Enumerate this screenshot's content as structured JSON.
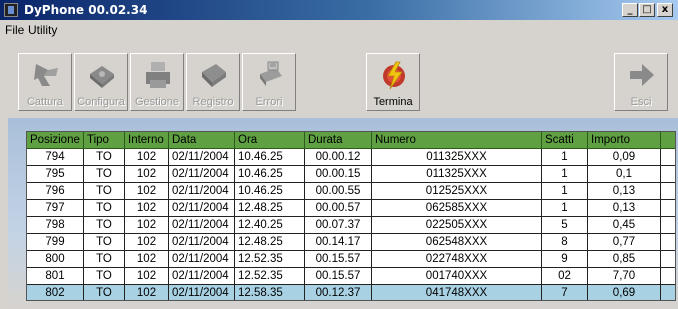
{
  "window": {
    "title": "DyPhone 00.02.34",
    "controls": [
      "_",
      "□",
      "x"
    ]
  },
  "menu": [
    "File",
    "Utility"
  ],
  "toolbar": [
    {
      "label": "Cattura",
      "icon": "capture-icon",
      "enabled": false
    },
    {
      "label": "Configura",
      "icon": "configure-icon",
      "enabled": false
    },
    {
      "label": "Gestione",
      "icon": "manage-icon",
      "enabled": false
    },
    {
      "label": "Registro",
      "icon": "register-icon",
      "enabled": false
    },
    {
      "label": "Errori",
      "icon": "errors-icon",
      "enabled": false
    },
    {
      "label": "Termina",
      "icon": "terminate-icon",
      "enabled": true
    },
    {
      "label": "Esci",
      "icon": "exit-arrow-icon",
      "enabled": false
    }
  ],
  "table": {
    "columns": [
      "Posizione",
      "Tipo",
      "Interno",
      "Data",
      "Ora",
      "Durata",
      "Numero",
      "Scatti",
      "Importo"
    ],
    "rows": [
      [
        "794",
        "TO",
        "102",
        "02/11/2004",
        "10.46.25",
        "00.00.12",
        "011325XXX",
        "1",
        "0,09"
      ],
      [
        "795",
        "TO",
        "102",
        "02/11/2004",
        "10.46.25",
        "00.00.15",
        "011325XXX",
        "1",
        "0,1"
      ],
      [
        "796",
        "TO",
        "102",
        "02/11/2004",
        "10.46.25",
        "00.00.55",
        "012525XXX",
        "1",
        "0,13"
      ],
      [
        "797",
        "TO",
        "102",
        "02/11/2004",
        "12.48.25",
        "00.00.57",
        "062585XXX",
        "1",
        "0,13"
      ],
      [
        "798",
        "TO",
        "102",
        "02/11/2004",
        "12.40.25",
        "00.07.37",
        "022505XXX",
        "5",
        "0,45"
      ],
      [
        "799",
        "TO",
        "102",
        "02/11/2004",
        "12.48.25",
        "00.14.17",
        "062548XXX",
        "8",
        "0,77"
      ],
      [
        "800",
        "TO",
        "102",
        "02/11/2004",
        "12.52.35",
        "00.15.57",
        "022748XXX",
        "9",
        "0,85"
      ],
      [
        "801",
        "TO",
        "102",
        "02/11/2004",
        "12.52.35",
        "00.15.57",
        "001740XXX",
        "02",
        "7,70"
      ],
      [
        "802",
        "TO",
        "102",
        "02/11/2004",
        "12.58.35",
        "00.12.37",
        "041748XXX",
        "7",
        "0,69"
      ]
    ],
    "selected_row": 8
  },
  "colors": {
    "header": "#5fa042",
    "selection": "#a8d2e4",
    "titlebar": "#0a246a"
  }
}
